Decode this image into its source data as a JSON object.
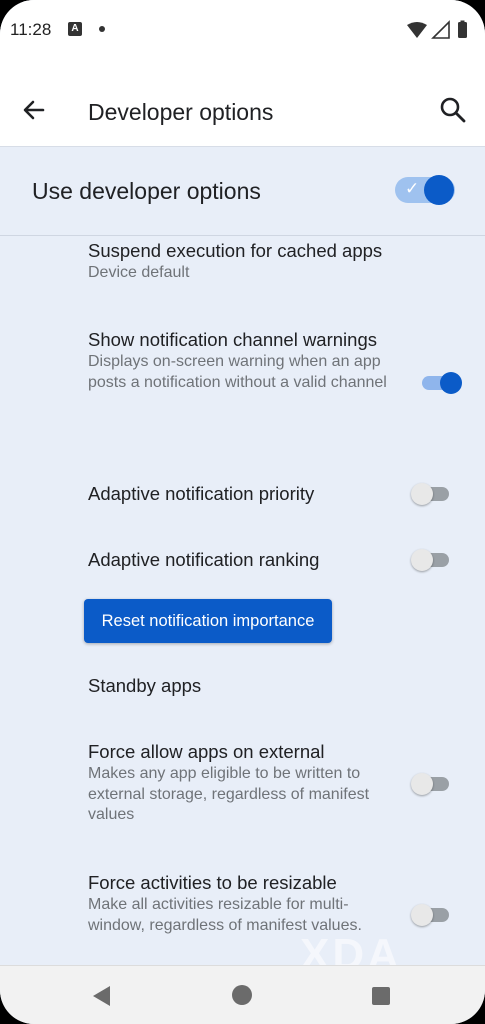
{
  "status_bar": {
    "time": "11:28",
    "notification_icon": "A"
  },
  "app_bar": {
    "title": "Developer options"
  },
  "master": {
    "label": "Use developer options",
    "enabled": true
  },
  "items": [
    {
      "title": "Suspend execution for cached apps",
      "subtitle": "Device default"
    },
    {
      "title": "Show notification channel warnings",
      "subtitle": "Displays on-screen warning when an app posts a notification without a valid channel",
      "enabled": true
    },
    {
      "title": "Adaptive notification priority",
      "enabled": false
    },
    {
      "title": "Adaptive notification ranking",
      "enabled": false
    },
    {
      "title": "Standby apps"
    },
    {
      "title": "Force allow apps on external",
      "subtitle": "Makes any app eligible to be written to external storage, regardless of manifest values",
      "enabled": false
    },
    {
      "title": "Force activities to be resizable",
      "subtitle": "Make all activities resizable for multi-window, regardless of manifest values.",
      "enabled": false
    }
  ],
  "reset_button": {
    "label": "Reset notification importance"
  },
  "watermark": "XDA",
  "colors": {
    "accent": "#0b5bc8",
    "background": "#e8eef8",
    "toggle_track_on": "#8fb5ec"
  },
  "icons": {
    "status": [
      "image-notification-icon",
      "dot-icon",
      "wifi-icon",
      "signal-icon",
      "battery-icon"
    ],
    "app_bar": [
      "back-arrow-icon",
      "search-icon"
    ],
    "nav": [
      "nav-back-icon",
      "nav-home-icon",
      "nav-recents-icon"
    ]
  }
}
